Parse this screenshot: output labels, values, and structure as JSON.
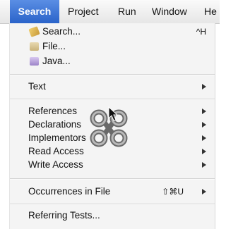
{
  "menubar": {
    "items": [
      {
        "label": "Search",
        "active": true
      },
      {
        "label": "Project",
        "active": false
      },
      {
        "label": "Run",
        "active": false
      },
      {
        "label": "Window",
        "active": false
      },
      {
        "label": "He",
        "active": false
      }
    ]
  },
  "menu": {
    "search": {
      "label": "Search...",
      "shortcut": "^H",
      "icon": "search-icon"
    },
    "file": {
      "label": "File...",
      "icon": "file-search-icon"
    },
    "java": {
      "label": "Java...",
      "icon": "java-search-icon"
    },
    "text": {
      "label": "Text"
    },
    "references": {
      "label": "References"
    },
    "declarations": {
      "label": "Declarations"
    },
    "implementors": {
      "label": "Implementors"
    },
    "read_access": {
      "label": "Read Access"
    },
    "write_access": {
      "label": "Write Access"
    },
    "occurrences": {
      "label": "Occurrences in File",
      "shortcut": "⇧⌘U"
    },
    "referring_tests": {
      "label": "Referring Tests..."
    }
  },
  "colors": {
    "menubar_active_bg": "#2a63c9",
    "menu_bg": "#f4f4f4"
  }
}
